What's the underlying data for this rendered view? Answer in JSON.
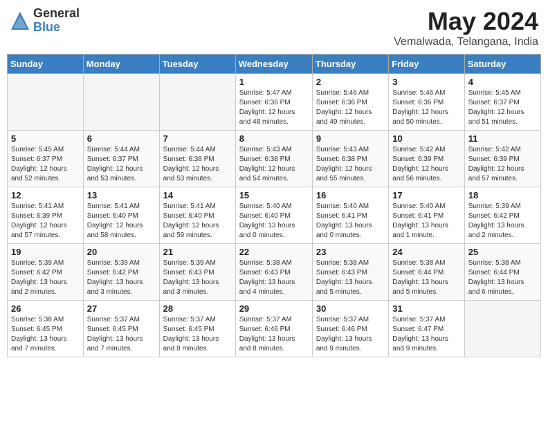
{
  "header": {
    "logo_general": "General",
    "logo_blue": "Blue",
    "month_year": "May 2024",
    "location": "Vemalwada, Telangana, India"
  },
  "days_of_week": [
    "Sunday",
    "Monday",
    "Tuesday",
    "Wednesday",
    "Thursday",
    "Friday",
    "Saturday"
  ],
  "weeks": [
    [
      {
        "day": "",
        "info": ""
      },
      {
        "day": "",
        "info": ""
      },
      {
        "day": "",
        "info": ""
      },
      {
        "day": "1",
        "info": "Sunrise: 5:47 AM\nSunset: 6:36 PM\nDaylight: 12 hours\nand 48 minutes."
      },
      {
        "day": "2",
        "info": "Sunrise: 5:46 AM\nSunset: 6:36 PM\nDaylight: 12 hours\nand 49 minutes."
      },
      {
        "day": "3",
        "info": "Sunrise: 5:46 AM\nSunset: 6:36 PM\nDaylight: 12 hours\nand 50 minutes."
      },
      {
        "day": "4",
        "info": "Sunrise: 5:45 AM\nSunset: 6:37 PM\nDaylight: 12 hours\nand 51 minutes."
      }
    ],
    [
      {
        "day": "5",
        "info": "Sunrise: 5:45 AM\nSunset: 6:37 PM\nDaylight: 12 hours\nand 52 minutes."
      },
      {
        "day": "6",
        "info": "Sunrise: 5:44 AM\nSunset: 6:37 PM\nDaylight: 12 hours\nand 53 minutes."
      },
      {
        "day": "7",
        "info": "Sunrise: 5:44 AM\nSunset: 6:38 PM\nDaylight: 12 hours\nand 53 minutes."
      },
      {
        "day": "8",
        "info": "Sunrise: 5:43 AM\nSunset: 6:38 PM\nDaylight: 12 hours\nand 54 minutes."
      },
      {
        "day": "9",
        "info": "Sunrise: 5:43 AM\nSunset: 6:38 PM\nDaylight: 12 hours\nand 55 minutes."
      },
      {
        "day": "10",
        "info": "Sunrise: 5:42 AM\nSunset: 6:39 PM\nDaylight: 12 hours\nand 56 minutes."
      },
      {
        "day": "11",
        "info": "Sunrise: 5:42 AM\nSunset: 6:39 PM\nDaylight: 12 hours\nand 57 minutes."
      }
    ],
    [
      {
        "day": "12",
        "info": "Sunrise: 5:41 AM\nSunset: 6:39 PM\nDaylight: 12 hours\nand 57 minutes."
      },
      {
        "day": "13",
        "info": "Sunrise: 5:41 AM\nSunset: 6:40 PM\nDaylight: 12 hours\nand 58 minutes."
      },
      {
        "day": "14",
        "info": "Sunrise: 5:41 AM\nSunset: 6:40 PM\nDaylight: 12 hours\nand 59 minutes."
      },
      {
        "day": "15",
        "info": "Sunrise: 5:40 AM\nSunset: 6:40 PM\nDaylight: 13 hours\nand 0 minutes."
      },
      {
        "day": "16",
        "info": "Sunrise: 5:40 AM\nSunset: 6:41 PM\nDaylight: 13 hours\nand 0 minutes."
      },
      {
        "day": "17",
        "info": "Sunrise: 5:40 AM\nSunset: 6:41 PM\nDaylight: 13 hours\nand 1 minute."
      },
      {
        "day": "18",
        "info": "Sunrise: 5:39 AM\nSunset: 6:42 PM\nDaylight: 13 hours\nand 2 minutes."
      }
    ],
    [
      {
        "day": "19",
        "info": "Sunrise: 5:39 AM\nSunset: 6:42 PM\nDaylight: 13 hours\nand 2 minutes."
      },
      {
        "day": "20",
        "info": "Sunrise: 5:39 AM\nSunset: 6:42 PM\nDaylight: 13 hours\nand 3 minutes."
      },
      {
        "day": "21",
        "info": "Sunrise: 5:39 AM\nSunset: 6:43 PM\nDaylight: 13 hours\nand 3 minutes."
      },
      {
        "day": "22",
        "info": "Sunrise: 5:38 AM\nSunset: 6:43 PM\nDaylight: 13 hours\nand 4 minutes."
      },
      {
        "day": "23",
        "info": "Sunrise: 5:38 AM\nSunset: 6:43 PM\nDaylight: 13 hours\nand 5 minutes."
      },
      {
        "day": "24",
        "info": "Sunrise: 5:38 AM\nSunset: 6:44 PM\nDaylight: 13 hours\nand 5 minutes."
      },
      {
        "day": "25",
        "info": "Sunrise: 5:38 AM\nSunset: 6:44 PM\nDaylight: 13 hours\nand 6 minutes."
      }
    ],
    [
      {
        "day": "26",
        "info": "Sunrise: 5:38 AM\nSunset: 6:45 PM\nDaylight: 13 hours\nand 7 minutes."
      },
      {
        "day": "27",
        "info": "Sunrise: 5:37 AM\nSunset: 6:45 PM\nDaylight: 13 hours\nand 7 minutes."
      },
      {
        "day": "28",
        "info": "Sunrise: 5:37 AM\nSunset: 6:45 PM\nDaylight: 13 hours\nand 8 minutes."
      },
      {
        "day": "29",
        "info": "Sunrise: 5:37 AM\nSunset: 6:46 PM\nDaylight: 13 hours\nand 8 minutes."
      },
      {
        "day": "30",
        "info": "Sunrise: 5:37 AM\nSunset: 6:46 PM\nDaylight: 13 hours\nand 9 minutes."
      },
      {
        "day": "31",
        "info": "Sunrise: 5:37 AM\nSunset: 6:47 PM\nDaylight: 13 hours\nand 9 minutes."
      },
      {
        "day": "",
        "info": ""
      }
    ]
  ]
}
